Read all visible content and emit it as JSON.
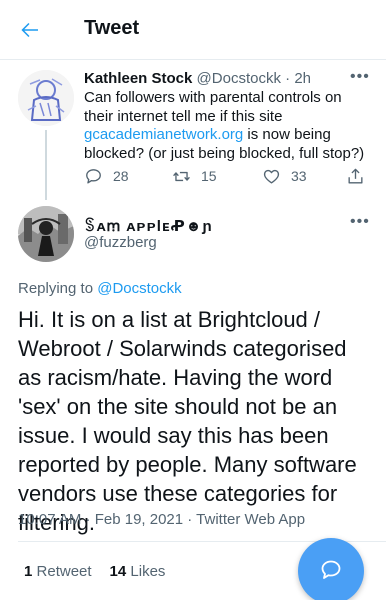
{
  "header": {
    "title": "Tweet"
  },
  "parent_tweet": {
    "name": "Kathleen Stock",
    "handle": "@Docstockk",
    "separator": "·",
    "time": "2h",
    "text_before": "Can followers with parental controls on their internet tell me if this site ",
    "link": "gcacademianetwork.org",
    "text_after": " is now being blocked? (or just being blocked, full stop?)",
    "replies": "28",
    "retweets": "15",
    "likes": "33"
  },
  "reply_tweet": {
    "name": "ꌗᴀꭑ ᴀᴘᴘlᴇꝒ☻ɲ",
    "handle": "@fuzzberg",
    "replying_prefix": "Replying to ",
    "replying_to": "@Docstockk",
    "text": "Hi. It is on a list at Brightcloud / Webroot / Solarwinds categorised as racism/hate.  Having the word 'sex' on the site should not be an issue. I would say this has been reported by people. Many software vendors use these categories for filtering.",
    "timestamp": "10:07 AM · Feb 19, 2021 · Twitter Web App",
    "retweet_count": "1",
    "retweet_label": "Retweet",
    "like_count": "14",
    "like_label": "Likes"
  },
  "icons": {
    "back": "back-arrow-icon",
    "more": "more-dots-icon",
    "reply": "reply-icon",
    "retweet": "retweet-icon",
    "like": "heart-icon",
    "share": "share-icon",
    "compose": "compose-reply-icon"
  },
  "colors": {
    "accent": "#1d9bf0",
    "fab": "#4a9ff5",
    "secondary_text": "#536471"
  }
}
